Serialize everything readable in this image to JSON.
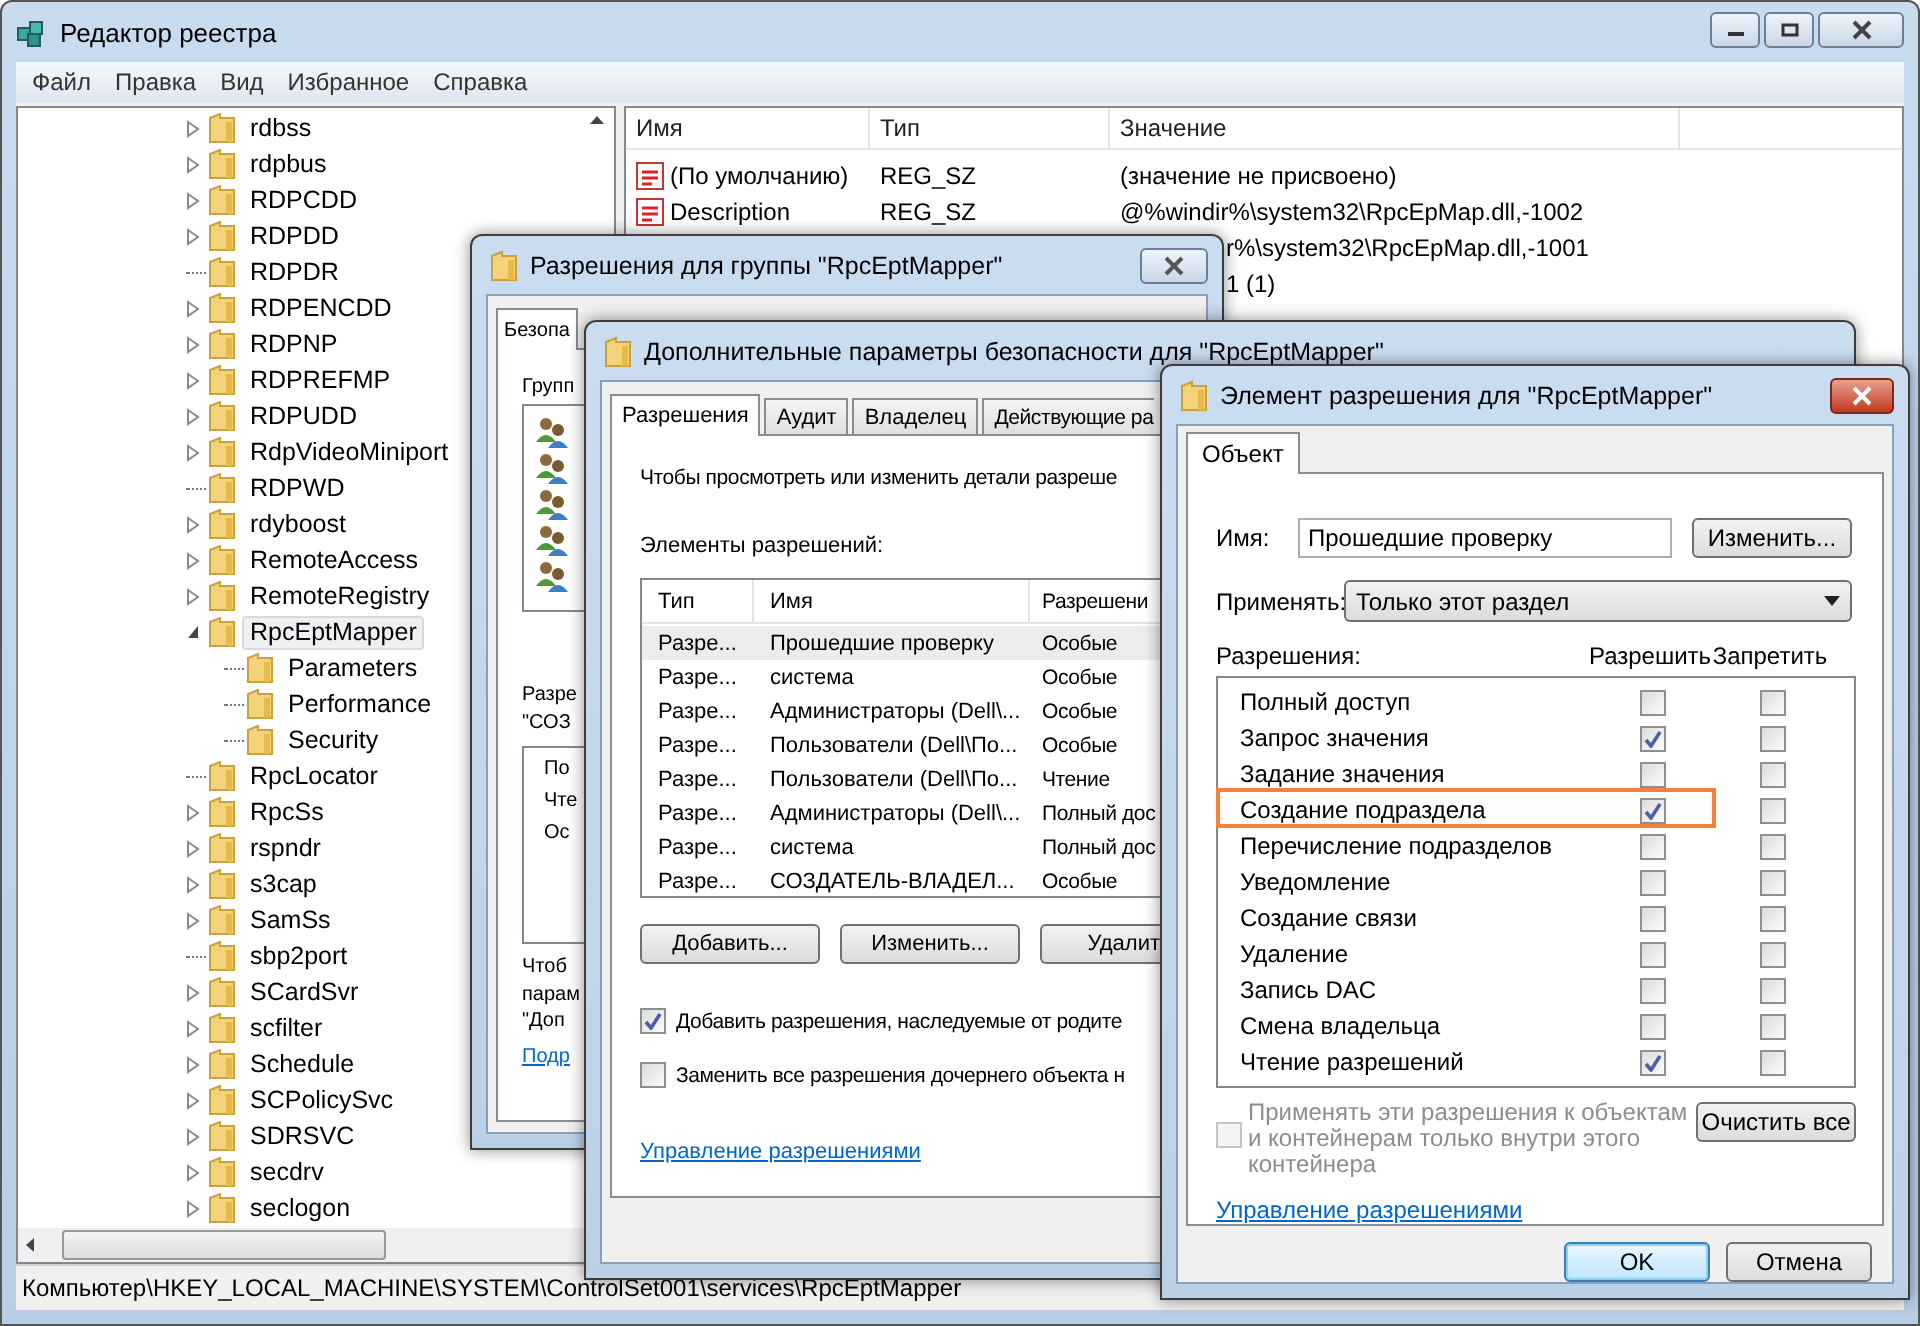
{
  "window": {
    "title": "Редактор реестра"
  },
  "menu": [
    "Файл",
    "Правка",
    "Вид",
    "Избранное",
    "Справка"
  ],
  "tree": [
    {
      "label": "rdbss",
      "expandable": true,
      "expanded": false,
      "selected": false
    },
    {
      "label": "rdpbus",
      "expandable": true,
      "expanded": false,
      "selected": false
    },
    {
      "label": "RDPCDD",
      "expandable": true,
      "expanded": false,
      "selected": false
    },
    {
      "label": "RDPDD",
      "expandable": true,
      "expanded": false,
      "selected": false
    },
    {
      "label": "RDPDR",
      "expandable": false,
      "selected": false
    },
    {
      "label": "RDPENCDD",
      "expandable": true,
      "expanded": false,
      "selected": false
    },
    {
      "label": "RDPNP",
      "expandable": true,
      "expanded": false,
      "selected": false
    },
    {
      "label": "RDPREFMP",
      "expandable": true,
      "expanded": false,
      "selected": false
    },
    {
      "label": "RDPUDD",
      "expandable": true,
      "expanded": false,
      "selected": false
    },
    {
      "label": "RdpVideoMiniport",
      "expandable": true,
      "expanded": false,
      "selected": false
    },
    {
      "label": "RDPWD",
      "expandable": false,
      "selected": false
    },
    {
      "label": "rdyboost",
      "expandable": true,
      "expanded": false,
      "selected": false
    },
    {
      "label": "RemoteAccess",
      "expandable": true,
      "expanded": false,
      "selected": false
    },
    {
      "label": "RemoteRegistry",
      "expandable": true,
      "expanded": false,
      "selected": false
    },
    {
      "label": "RpcEptMapper",
      "expandable": true,
      "expanded": true,
      "selected": true,
      "children": [
        {
          "label": "Parameters",
          "expandable": false,
          "selected": false
        },
        {
          "label": "Performance",
          "expandable": false,
          "selected": false
        },
        {
          "label": "Security",
          "expandable": false,
          "selected": false
        }
      ]
    },
    {
      "label": "RpcLocator",
      "expandable": false,
      "selected": false
    },
    {
      "label": "RpcSs",
      "expandable": true,
      "expanded": false,
      "selected": false
    },
    {
      "label": "rspndr",
      "expandable": true,
      "expanded": false,
      "selected": false
    },
    {
      "label": "s3cap",
      "expandable": true,
      "expanded": false,
      "selected": false
    },
    {
      "label": "SamSs",
      "expandable": true,
      "expanded": false,
      "selected": false
    },
    {
      "label": "sbp2port",
      "expandable": false,
      "selected": false
    },
    {
      "label": "SCardSvr",
      "expandable": true,
      "expanded": false,
      "selected": false
    },
    {
      "label": "scfilter",
      "expandable": true,
      "expanded": false,
      "selected": false
    },
    {
      "label": "Schedule",
      "expandable": true,
      "expanded": false,
      "selected": false
    },
    {
      "label": "SCPolicySvc",
      "expandable": true,
      "expanded": false,
      "selected": false
    },
    {
      "label": "SDRSVC",
      "expandable": true,
      "expanded": false,
      "selected": false
    },
    {
      "label": "secdrv",
      "expandable": true,
      "expanded": false,
      "selected": false
    },
    {
      "label": "seclogon",
      "expandable": true,
      "expanded": false,
      "selected": false
    }
  ],
  "values": {
    "columns": [
      "Имя",
      "Тип",
      "Значение"
    ],
    "rows": [
      {
        "name": "(По умолчанию)",
        "type": "REG_SZ",
        "value": "(значение не присвоено)"
      },
      {
        "name": "Description",
        "type": "REG_SZ",
        "value": "@%windir%\\system32\\RpcEpMap.dll,-1002"
      },
      {
        "value": "r%\\system32\\RpcEpMap.dll,-1001"
      },
      {
        "value": "1 (1)"
      }
    ]
  },
  "status_bar": "Компьютер\\HKEY_LOCAL_MACHINE\\SYSTEM\\ControlSet001\\services\\RpcEptMapper",
  "group_dialog": {
    "title": "Разрешения для группы \"RpcEptMapper\"",
    "tab": "Безопа",
    "groups_label": "Групп",
    "permissions_label": [
      "Разре",
      "\"СОЗ"
    ],
    "permission_rows": [
      "По",
      "Чте",
      "Ос"
    ],
    "note": [
      "Чтоб",
      "парам",
      "\"Доп"
    ],
    "link": "Подр"
  },
  "advanced_dialog": {
    "title": "Дополнительные параметры безопасности  для \"RpcEptMapper\"",
    "tabs": [
      {
        "label": "Разрешения",
        "selected": true
      },
      {
        "label": "Аудит",
        "selected": false
      },
      {
        "label": "Владелец",
        "selected": false
      },
      {
        "label": "Действующие ра",
        "selected": false
      }
    ],
    "intro": "Чтобы просмотреть или изменить детали разреше",
    "entries_label": "Элементы разрешений:",
    "columns": [
      "Тип",
      "Имя",
      "Разрешени"
    ],
    "rows": [
      {
        "type": "Разре...",
        "name": "Прошедшие проверку",
        "permission": "Особые",
        "selected": true
      },
      {
        "type": "Разре...",
        "name": "система",
        "permission": "Особые",
        "selected": false
      },
      {
        "type": "Разре...",
        "name": "Администраторы (Dell\\...",
        "permission": "Особые",
        "selected": false
      },
      {
        "type": "Разре...",
        "name": "Пользователи (Dell\\По...",
        "permission": "Особые",
        "selected": false
      },
      {
        "type": "Разре...",
        "name": "Пользователи (Dell\\По...",
        "permission": "Чтение",
        "selected": false
      },
      {
        "type": "Разре...",
        "name": "Администраторы (Dell\\...",
        "permission": "Полный дос",
        "selected": false
      },
      {
        "type": "Разре...",
        "name": "система",
        "permission": "Полный дос",
        "selected": false
      },
      {
        "type": "Разре...",
        "name": "СОЗДАТЕЛЬ-ВЛАДЕЛ...",
        "permission": "Особые",
        "selected": false
      }
    ],
    "buttons": [
      "Добавить...",
      "Изменить...",
      "Удалит"
    ],
    "options": [
      {
        "label": "Добавить разрешения, наследуемые от родите",
        "checked": true
      },
      {
        "label": "Заменить все разрешения дочернего объекта н",
        "checked": false
      }
    ],
    "link": "Управление разрешениями"
  },
  "entry_dialog": {
    "title": "Элемент разрешения для \"RpcEptMapper\"",
    "tab": "Объект",
    "name_label": "Имя:",
    "name_value": "Прошедшие проверку",
    "change_button": "Изменить...",
    "apply_label": "Применять:",
    "apply_value": "Только этот раздел",
    "permissions_label": "Разрешения:",
    "allow_header": "Разрешить",
    "deny_header": "Запретить",
    "permissions": [
      {
        "label": "Полный доступ",
        "allow": false,
        "deny": false,
        "highlighted": false
      },
      {
        "label": "Запрос значения",
        "allow": true,
        "deny": false,
        "highlighted": false
      },
      {
        "label": "Задание значения",
        "allow": false,
        "deny": false,
        "highlighted": false
      },
      {
        "label": "Создание подраздела",
        "allow": true,
        "deny": false,
        "highlighted": true
      },
      {
        "label": "Перечисление подразделов",
        "allow": false,
        "deny": false,
        "highlighted": false
      },
      {
        "label": "Уведомление",
        "allow": false,
        "deny": false,
        "highlighted": false
      },
      {
        "label": "Создание связи",
        "allow": false,
        "deny": false,
        "highlighted": false
      },
      {
        "label": "Удаление",
        "allow": false,
        "deny": false,
        "highlighted": false
      },
      {
        "label": "Запись DAC",
        "allow": false,
        "deny": false,
        "highlighted": false
      },
      {
        "label": "Смена владельца",
        "allow": false,
        "deny": false,
        "highlighted": false
      },
      {
        "label": "Чтение разрешений",
        "allow": true,
        "deny": false,
        "highlighted": false
      }
    ],
    "inherit": {
      "label": "Применять эти разрешения к объектам и контейнерам только внутри этого контейнера",
      "checked": false,
      "disabled": true
    },
    "clear_button": "Очистить все",
    "link": "Управление разрешениями",
    "buttons": [
      {
        "label": "OK",
        "default": true
      },
      {
        "label": "Отмена",
        "default": false
      }
    ]
  }
}
